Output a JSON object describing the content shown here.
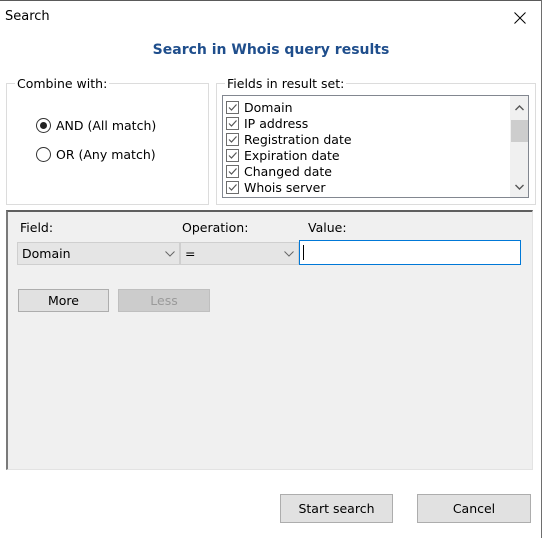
{
  "window": {
    "title": "Search",
    "close_icon": "close-icon"
  },
  "heading": "Search in Whois query results",
  "combine": {
    "legend": "Combine with:",
    "options": [
      {
        "label": "AND (All match)",
        "selected": true
      },
      {
        "label": "OR (Any match)",
        "selected": false
      }
    ]
  },
  "fields": {
    "legend": "Fields in result set:",
    "items": [
      {
        "label": "Domain",
        "checked": true
      },
      {
        "label": "IP address",
        "checked": true
      },
      {
        "label": "Registration date",
        "checked": true
      },
      {
        "label": "Expiration date",
        "checked": true
      },
      {
        "label": "Changed date",
        "checked": true
      },
      {
        "label": "Whois server",
        "checked": true
      }
    ]
  },
  "criteria": {
    "field_label": "Field:",
    "operation_label": "Operation:",
    "value_label": "Value:",
    "rows": [
      {
        "field": "Domain",
        "operation": "=",
        "value": ""
      }
    ],
    "more_label": "More",
    "less_label": "Less"
  },
  "footer": {
    "start_label": "Start search",
    "cancel_label": "Cancel"
  },
  "colors": {
    "heading": "#1f4e8c",
    "input_focus": "#0078d7"
  }
}
